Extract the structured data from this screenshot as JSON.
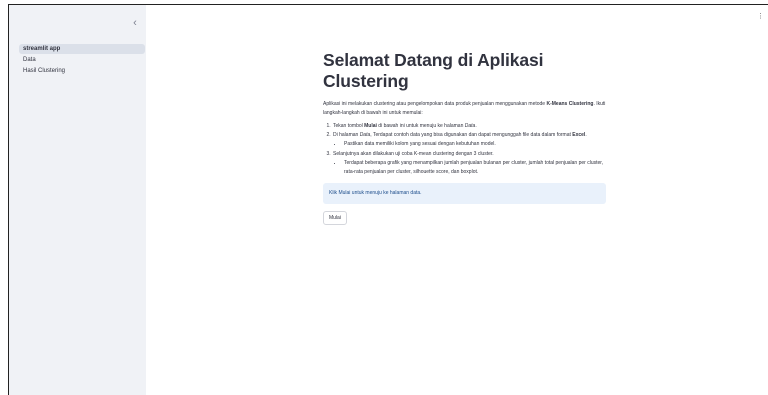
{
  "sidebar": {
    "collapse_icon": "chevron-left-icon",
    "collapse_glyph": "‹",
    "items": [
      {
        "label": "streamlit app",
        "active": true
      },
      {
        "label": "Data",
        "active": false
      },
      {
        "label": "Hasil Clustering",
        "active": false
      }
    ]
  },
  "header": {
    "menu_icon": "kebab-menu-icon",
    "menu_glyph": "⋮"
  },
  "main": {
    "title": "Selamat Datang di Aplikasi Clustering",
    "intro_1": "Aplikasi ini melakukan clustering atau pengelompokan data produk penjualan menggunakan metode ",
    "intro_bold": "K-Means Clustering",
    "intro_2": ". Ikuti langkah-langkah di bawah ini untuk memulai:",
    "step1_a": "Tekan tombol ",
    "step1_bold": "Mulai",
    "step1_b": " di bawah ini untuk menuju ke halaman ",
    "step1_italic": "Data",
    "step1_c": ".",
    "step2_a": "Di halaman ",
    "step2_italic": "Data",
    "step2_b": ", Terdapat contoh data yang bisa digunakan dan dapat mengunggah file data dalam format ",
    "step2_bold": "Excel",
    "step2_c": ".",
    "step2_sub": "Pastikan data memiliki kolom yang sesuai dengan kebutuhan model.",
    "step3": "Selanjutnya akan dilakukan uji coba K-mean clustering dengan 3 cluster.",
    "step3_sub": "Terdapat beberapa grafik yang menampilkan jumlah penjualan bulanan per cluster, jumlah total penjualan per cluster, rata-rata penjualan per cluster, silhouette score, dan boxplot.",
    "info_text": "Klik Mulai untuk menuju ke halaman data.",
    "button_label": "Mulai"
  },
  "colors": {
    "sidebar_bg": "#f0f2f6",
    "active_item_bg": "#dbe0e9",
    "info_bg": "#e9f1fb",
    "info_text": "#1e4e8c"
  }
}
